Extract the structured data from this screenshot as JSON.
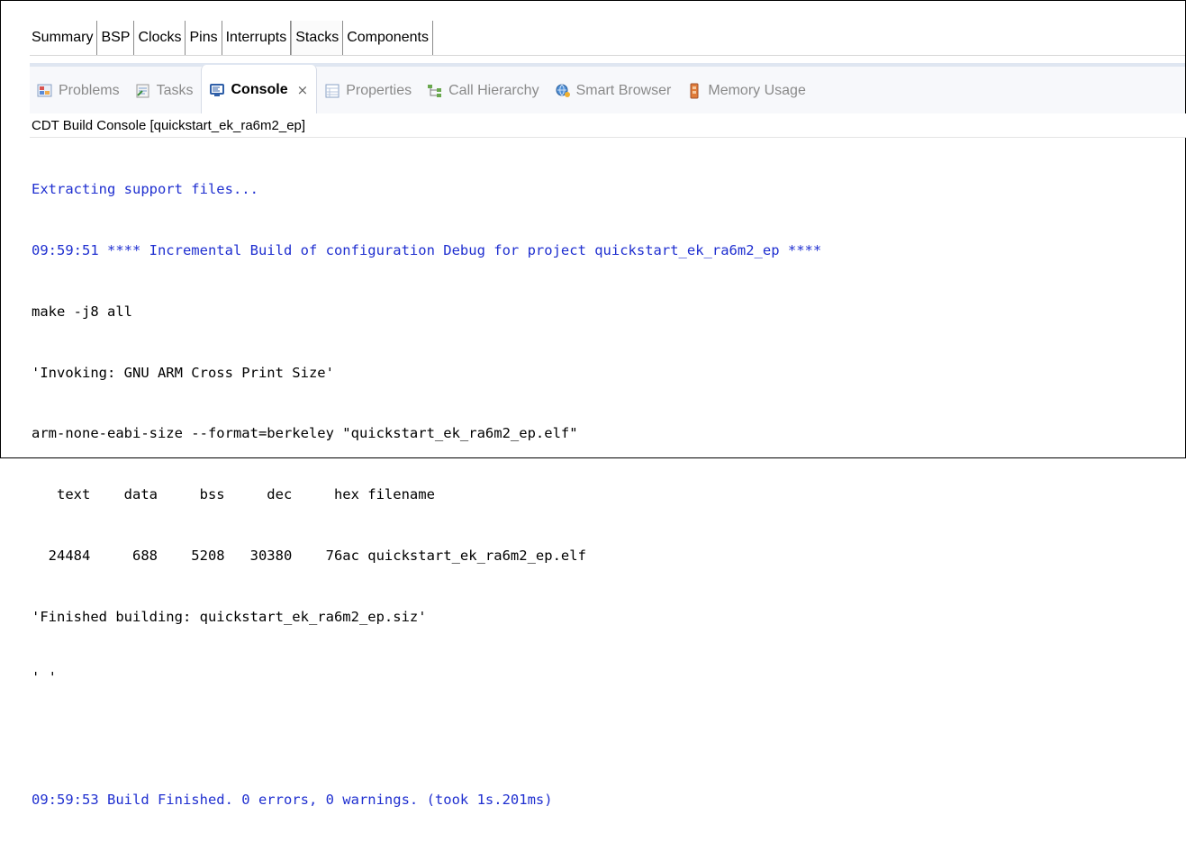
{
  "config_tabs": [
    {
      "label": "Summary"
    },
    {
      "label": "BSP"
    },
    {
      "label": "Clocks"
    },
    {
      "label": "Pins"
    },
    {
      "label": "Interrupts"
    },
    {
      "label": "Stacks"
    },
    {
      "label": "Components"
    }
  ],
  "view_tabs": [
    {
      "label": "Problems",
      "icon": "problems-icon"
    },
    {
      "label": "Tasks",
      "icon": "tasks-icon"
    },
    {
      "label": "Console",
      "icon": "console-icon",
      "close": "⨯"
    },
    {
      "label": "Properties",
      "icon": "properties-icon"
    },
    {
      "label": "Call Hierarchy",
      "icon": "call-hierarchy-icon"
    },
    {
      "label": "Smart Browser",
      "icon": "smart-browser-icon"
    },
    {
      "label": "Memory Usage",
      "icon": "memory-usage-icon"
    }
  ],
  "console": {
    "title": "CDT Build Console [quickstart_ek_ra6m2_ep]",
    "lines": [
      {
        "text": "Extracting support files...",
        "color": "blue"
      },
      {
        "text": "09:59:51 **** Incremental Build of configuration Debug for project quickstart_ek_ra6m2_ep ****",
        "color": "blue"
      },
      {
        "text": "make -j8 all",
        "color": "black"
      },
      {
        "text": "'Invoking: GNU ARM Cross Print Size'",
        "color": "black"
      },
      {
        "text": "arm-none-eabi-size --format=berkeley \"quickstart_ek_ra6m2_ep.elf\"",
        "color": "black"
      },
      {
        "text": "   text    data     bss     dec     hex filename",
        "color": "black"
      },
      {
        "text": "  24484     688    5208   30380    76ac quickstart_ek_ra6m2_ep.elf",
        "color": "black"
      },
      {
        "text": "'Finished building: quickstart_ek_ra6m2_ep.siz'",
        "color": "black"
      },
      {
        "text": "' '",
        "color": "black"
      },
      {
        "text": "",
        "color": "black"
      },
      {
        "text": "09:59:53 Build Finished. 0 errors, 0 warnings. (took 1s.201ms)",
        "color": "blue"
      }
    ]
  }
}
